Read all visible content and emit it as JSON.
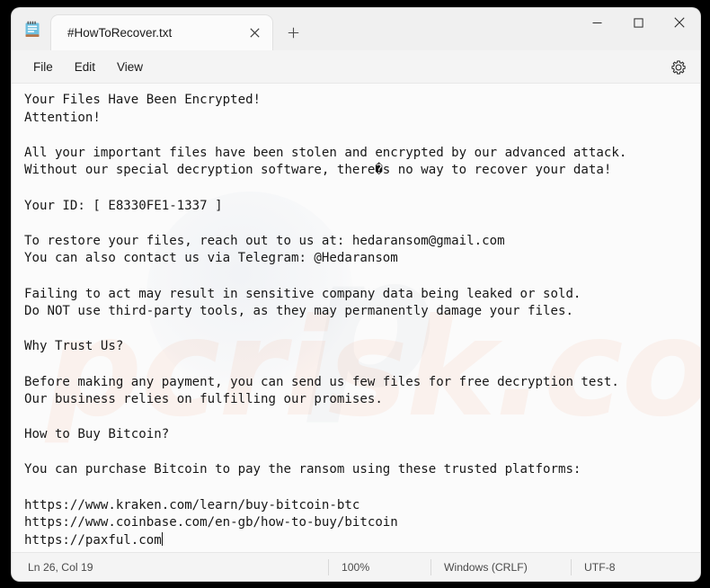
{
  "window": {
    "app_icon": "notepad-icon",
    "minimize_label": "—",
    "maximize_label": "□",
    "close_label": "✕"
  },
  "tab": {
    "title": "#HowToRecover.txt",
    "close_label": "✕",
    "new_tab_label": "+"
  },
  "menubar": {
    "items": [
      {
        "label": "File"
      },
      {
        "label": "Edit"
      },
      {
        "label": "View"
      }
    ],
    "settings_icon": "gear-icon"
  },
  "document": {
    "lines": [
      "Your Files Have Been Encrypted!",
      "Attention!",
      "",
      "All your important files have been stolen and encrypted by our advanced attack.",
      "Without our special decryption software, there�s no way to recover your data!",
      "",
      "Your ID: [ E8330FE1-1337 ]",
      "",
      "To restore your files, reach out to us at: hedaransom@gmail.com",
      "You can also contact us via Telegram: @Hedaransom",
      "",
      "Failing to act may result in sensitive company data being leaked or sold.",
      "Do NOT use third-party tools, as they may permanently damage your files.",
      "",
      "Why Trust Us?",
      "",
      "Before making any payment, you can send us few files for free decryption test.",
      "Our business relies on fulfilling our promises.",
      "",
      "How to Buy Bitcoin?",
      "",
      "You can purchase Bitcoin to pay the ransom using these trusted platforms:",
      "",
      "https://www.kraken.com/learn/buy-bitcoin-btc",
      "https://www.coinbase.com/en-gb/how-to-buy/bitcoin",
      "https://paxful.com"
    ]
  },
  "watermark": {
    "text": "pcrisk.com"
  },
  "statusbar": {
    "cursor": "Ln 26, Col 19",
    "zoom": "100%",
    "line_ending": "Windows (CRLF)",
    "encoding": "UTF-8"
  }
}
